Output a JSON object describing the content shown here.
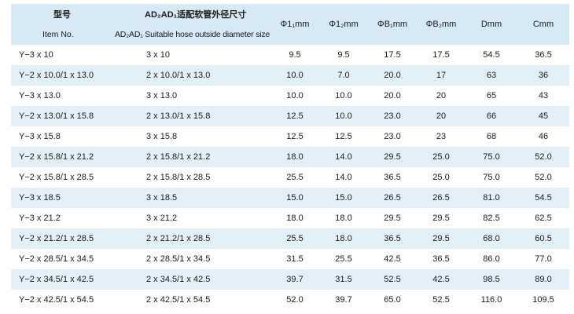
{
  "header": {
    "col_item_cn": "型号",
    "col_item_en": "Item No.",
    "col_hose_cn": "AD₂AD₁适配软管外径尺寸",
    "col_hose_en": "AD₂AD₁ Suitable hose outside diameter size",
    "col_phi1": "Φ1₁mm",
    "col_phi2": "Φ1₂mm",
    "col_b1": "ΦB₁mm",
    "col_b2": "ΦB₂mm",
    "col_d": "Dmm",
    "col_c": "Cmm"
  },
  "rows": [
    {
      "item": "Y−3 x 10",
      "hose": "3 x 10",
      "phi1": "9.5",
      "phi2": "9.5",
      "b1": "17.5",
      "b2": "17.5",
      "d": "54.5",
      "c": "36.5"
    },
    {
      "item": "Y−2 x 10.0/1 x 13.0",
      "hose": "2 x 10.0/1 x 13.0",
      "phi1": "10.0",
      "phi2": "7.0",
      "b1": "20.0",
      "b2": "17",
      "d": "63",
      "c": "36"
    },
    {
      "item": "Y−3 x 13.0",
      "hose": "3 x 13.0",
      "phi1": "10.0",
      "phi2": "10.0",
      "b1": "20.0",
      "b2": "20",
      "d": "65",
      "c": "43"
    },
    {
      "item": "Y−2 x 13.0/1 x 15.8",
      "hose": "2 x 13.0/1 x 15.8",
      "phi1": "12.5",
      "phi2": "10.0",
      "b1": "23.0",
      "b2": "20",
      "d": "66",
      "c": "45"
    },
    {
      "item": "Y−3 x 15.8",
      "hose": "3 x 15.8",
      "phi1": "12.5",
      "phi2": "12.5",
      "b1": "23.0",
      "b2": "23",
      "d": "68",
      "c": "46"
    },
    {
      "item": "Y−2 x 15.8/1 x 21.2",
      "hose": "2 x 15.8/1 x 21.2",
      "phi1": "18.0",
      "phi2": "14.0",
      "b1": "29.5",
      "b2": "25.0",
      "d": "75.0",
      "c": "52.0"
    },
    {
      "item": "Y−2 x 15.8/1 x 28.5",
      "hose": "2 x 15.8/1 x 28.5",
      "phi1": "25.5",
      "phi2": "14.0",
      "b1": "36.5",
      "b2": "25.0",
      "d": "75.0",
      "c": "52.0"
    },
    {
      "item": "Y−3 x 18.5",
      "hose": "3 x 18.5",
      "phi1": "15.0",
      "phi2": "15.0",
      "b1": "26.5",
      "b2": "26.5",
      "d": "81.0",
      "c": "54.5"
    },
    {
      "item": "Y−3 x 21.2",
      "hose": "3 x 21.2",
      "phi1": "18.0",
      "phi2": "18.0",
      "b1": "29.5",
      "b2": "29.5",
      "d": "82.5",
      "c": "62.5"
    },
    {
      "item": "Y−2 x 21.2/1 x 28.5",
      "hose": "2 x 21.2/1 x 28.5",
      "phi1": "25.5",
      "phi2": "18.0",
      "b1": "36.5",
      "b2": "29.5",
      "d": "68.0",
      "c": "60.5"
    },
    {
      "item": "Y−2 x 28.5/1 x 34.5",
      "hose": "2 x 28.5/1 x 34.5",
      "phi1": "31.5",
      "phi2": "25.5",
      "b1": "42.5",
      "b2": "36.5",
      "d": "86.0",
      "c": "77.0"
    },
    {
      "item": "Y−2 x 34.5/1 x 42.5",
      "hose": "2 x 34.5/1 x 42.5",
      "phi1": "39.7",
      "phi2": "31.5",
      "b1": "52.5",
      "b2": "42.5",
      "d": "98.5",
      "c": "89.0"
    },
    {
      "item": "Y−2 x 42.5/1 x 54.5",
      "hose": "2 x 42.5/1 x 54.5",
      "phi1": "52.0",
      "phi2": "39.7",
      "b1": "65.0",
      "b2": "52.5",
      "d": "116.0",
      "c": "109.5"
    }
  ],
  "colors": {
    "header_bg": "#d7e9f5",
    "stripe_bg": "#e4f0f8"
  }
}
